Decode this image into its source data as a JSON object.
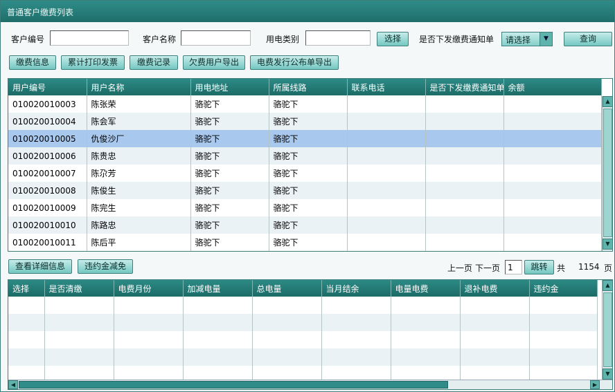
{
  "window": {
    "title": "普通客户缴费列表"
  },
  "filters": {
    "customer_no_label": "客户编号",
    "customer_no_value": "",
    "customer_name_label": "客户名称",
    "customer_name_value": "",
    "elec_type_label": "用电类别",
    "elec_type_value": "",
    "select_button": "选择",
    "notice_label": "是否下发缴费通知单",
    "notice_select": "请选择",
    "query_button": "查询"
  },
  "toolbar": {
    "payment_info": "缴费信息",
    "cumulative_invoice": "累计打印发票",
    "payment_record": "缴费记录",
    "arrears_export": "欠费用户导出",
    "bulletin_export": "电费发行公布单导出"
  },
  "customer_table": {
    "columns": [
      "用户编号",
      "用户名称",
      "用电地址",
      "所属线路",
      "联系电话",
      "是否下发缴费通知单",
      "余额"
    ],
    "rows": [
      [
        "010020010003",
        "陈张荣",
        "骆驼下",
        "骆驼下",
        "",
        "",
        ""
      ],
      [
        "010020010004",
        "陈会军",
        "骆驼下",
        "骆驼下",
        "",
        "",
        ""
      ],
      [
        "010020010005",
        "仇俊沙厂",
        "骆驼下",
        "骆驼下",
        "",
        "",
        ""
      ],
      [
        "010020010006",
        "陈贵忠",
        "骆驼下",
        "骆驼下",
        "",
        "",
        ""
      ],
      [
        "010020010007",
        "陈尕芳",
        "骆驼下",
        "骆驼下",
        "",
        "",
        ""
      ],
      [
        "010020010008",
        "陈俊生",
        "骆驼下",
        "骆驼下",
        "",
        "",
        ""
      ],
      [
        "010020010009",
        "陈完生",
        "骆驼下",
        "骆驼下",
        "",
        "",
        ""
      ],
      [
        "010020010010",
        "陈路忠",
        "骆驼下",
        "骆驼下",
        "",
        "",
        ""
      ],
      [
        "010020010011",
        "陈后平",
        "骆驼下",
        "骆驼下",
        "",
        "",
        ""
      ]
    ],
    "selected_row": 2
  },
  "actions": {
    "view_detail": "查看详细信息",
    "penalty_relief": "违约金减免"
  },
  "pager": {
    "prev": "上一页",
    "next": "下一页",
    "page_value": "1",
    "jump": "跳转",
    "total_prefix": "共",
    "total_pages": "1154",
    "total_suffix": "页"
  },
  "detail_table": {
    "columns": [
      "选择",
      "是否清缴",
      "电费月份",
      "加减电量",
      "总电量",
      "当月结余",
      "电量电费",
      "退补电费",
      "违约金"
    ],
    "rows": [
      [
        "",
        "",
        "",
        "",
        "",
        "",
        "",
        "",
        ""
      ],
      [
        "",
        "",
        "",
        "",
        "",
        "",
        "",
        "",
        ""
      ],
      [
        "",
        "",
        "",
        "",
        "",
        "",
        "",
        "",
        ""
      ],
      [
        "",
        "",
        "",
        "",
        "",
        "",
        "",
        "",
        ""
      ],
      [
        "",
        "",
        "",
        "",
        "",
        "",
        "",
        "",
        ""
      ]
    ]
  },
  "icons": {
    "dropdown": "chevron-down-icon",
    "scroll_up": "arrow-up-icon",
    "scroll_down": "arrow-down-icon",
    "scroll_left": "arrow-left-icon",
    "scroll_right": "arrow-right-icon"
  },
  "colors": {
    "header_teal": "#1f6e6b",
    "button_teal": "#74c7c1",
    "selected_row": "#a9c8ee",
    "alt_row": "#eaf2f5"
  }
}
